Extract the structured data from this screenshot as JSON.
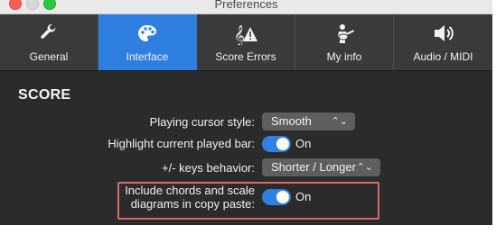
{
  "window": {
    "title": "Preferences"
  },
  "tabs": [
    {
      "label": "General",
      "icon": "wrench-icon",
      "active": false
    },
    {
      "label": "Interface",
      "icon": "palette-icon",
      "active": true
    },
    {
      "label": "Score Errors",
      "icon": "clef-warning-icon",
      "active": false
    },
    {
      "label": "My info",
      "icon": "guitarist-icon",
      "active": false
    },
    {
      "label": "Audio / MIDI",
      "icon": "speaker-icon",
      "active": false
    }
  ],
  "section": {
    "title": "SCORE"
  },
  "settings": {
    "cursor_style": {
      "label": "Playing cursor style:",
      "value": "Smooth"
    },
    "highlight_bar": {
      "label": "Highlight current played bar:",
      "state": "On"
    },
    "keys_behavior": {
      "label": "+/- keys behavior:",
      "value": "Shorter / Longer"
    },
    "include_chords": {
      "label_line1": "Include chords and scale",
      "label_line2": "diagrams in copy paste:",
      "state": "On"
    }
  },
  "colors": {
    "accent": "#2f7fe0",
    "highlight_border": "#d96a6a"
  }
}
